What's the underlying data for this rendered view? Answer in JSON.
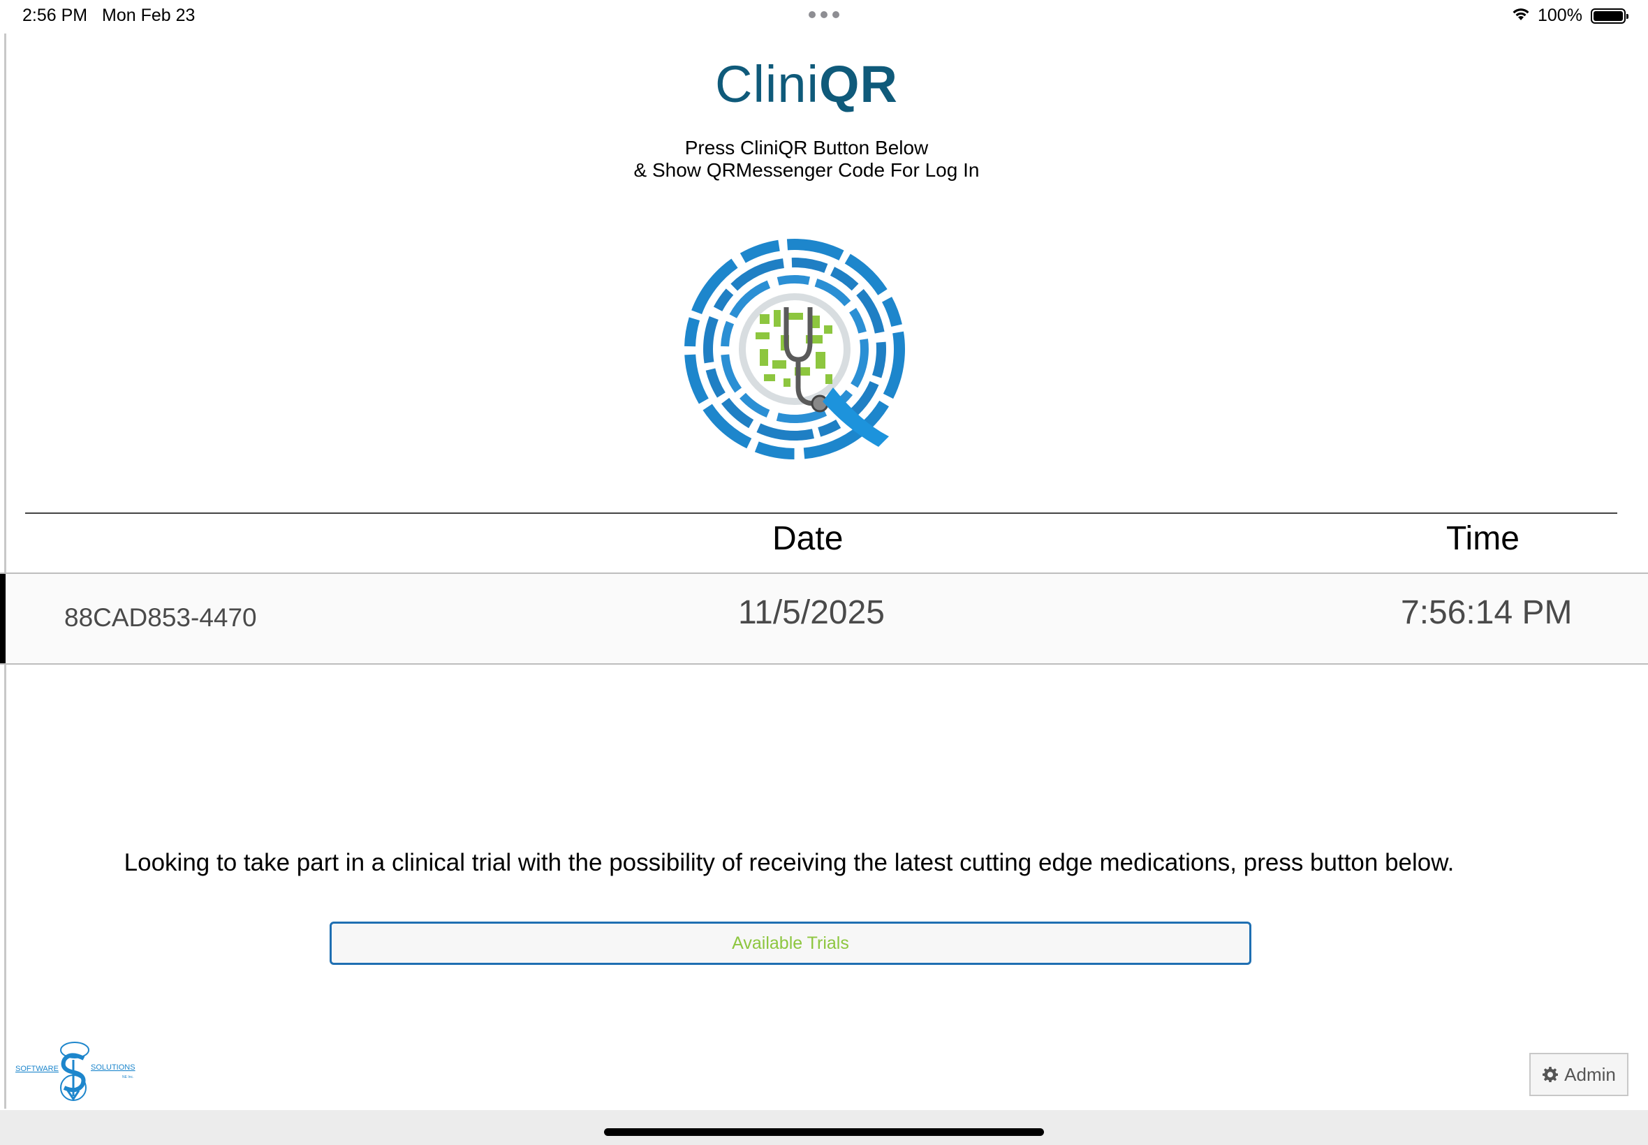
{
  "status_bar": {
    "time": "2:56 PM",
    "date": "Mon Feb 23",
    "battery": "100%",
    "icons": [
      "wifi-icon",
      "battery-icon",
      "multitask-dots-icon"
    ]
  },
  "brand": {
    "name_light": "Clini",
    "name_bold": "QR",
    "color": "#0f5a7a",
    "logo_icon": "cliniqr-logo-icon"
  },
  "instructions": {
    "line1": "Press CliniQR Button Below",
    "line2": "& Show QRMessenger Code For Log In"
  },
  "table": {
    "headers": {
      "date": "Date",
      "time": "Time"
    },
    "rows": [
      {
        "id": "88CAD853-4470",
        "date": "11/5/2025",
        "time": "7:56:14 PM"
      }
    ]
  },
  "trials": {
    "prompt": "Looking to take part in a clinical trial with the possibility of receiving the latest cutting edge medications, press button below.",
    "button_label": "Available Trials",
    "button_text_color": "#8dc63f",
    "button_border_color": "#1f6fb2"
  },
  "footer": {
    "company_logo_left": "SOFTWARE",
    "company_logo_right": "SOLUTIONS",
    "company_logo_small": "NE Inc.",
    "admin_label": "Admin",
    "admin_icon": "gear-icon"
  }
}
